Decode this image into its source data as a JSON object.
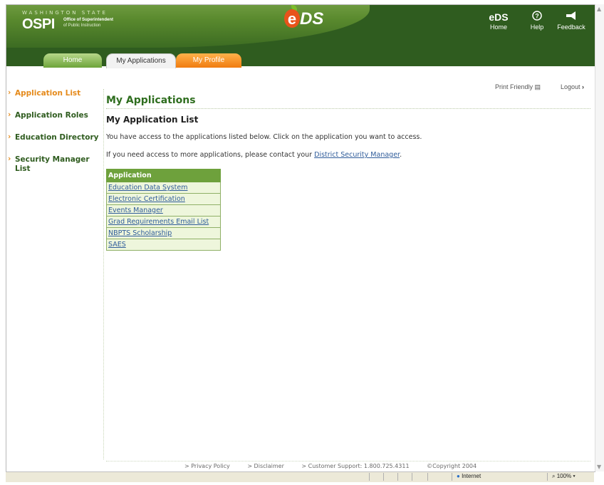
{
  "header": {
    "state_text": "WASHINGTON STATE",
    "agency_abbr": "OSPI",
    "agency_line1": "Office of Superintendent",
    "agency_line2": "of Public Instruction",
    "app_logo_e": "e",
    "app_logo_ds": "DS",
    "home_icon_text": "eDS",
    "home_label": "Home",
    "help_label": "Help",
    "feedback_label": "Feedback"
  },
  "tabs": [
    {
      "label": "Home"
    },
    {
      "label": "My Applications"
    },
    {
      "label": "My Profile"
    }
  ],
  "utility": {
    "print_label": "Print Friendly",
    "logout_label": "Logout"
  },
  "sidebar": {
    "items": [
      {
        "label": "Application List",
        "active": true
      },
      {
        "label": "Application Roles"
      },
      {
        "label": "Education Directory"
      },
      {
        "label": "Security Manager List"
      }
    ]
  },
  "main": {
    "title": "My Applications",
    "subtitle": "My Application List",
    "para1": "You have access to the applications listed below. Click on the application you want to access.",
    "para2_prefix": "If you need access to more applications, please contact your ",
    "para2_link": "District Security Manager",
    "para2_suffix": ".",
    "table_header": "Application",
    "applications": [
      "Education Data System",
      "Electronic Certification",
      "Events Manager",
      "Grad Requirements Email List",
      "NBPTS Scholarship",
      "SAES"
    ]
  },
  "footer": {
    "privacy": "> Privacy Policy",
    "disclaimer": "> Disclaimer",
    "support": "> Customer Support: 1.800.725.4311",
    "copyright": "©Copyright 2004"
  },
  "statusbar": {
    "zone": "Internet",
    "zoom": "100%"
  },
  "colors": {
    "header_green": "#2f5c1f",
    "accent_orange": "#e58a1b",
    "table_header_green": "#6ea13c"
  }
}
